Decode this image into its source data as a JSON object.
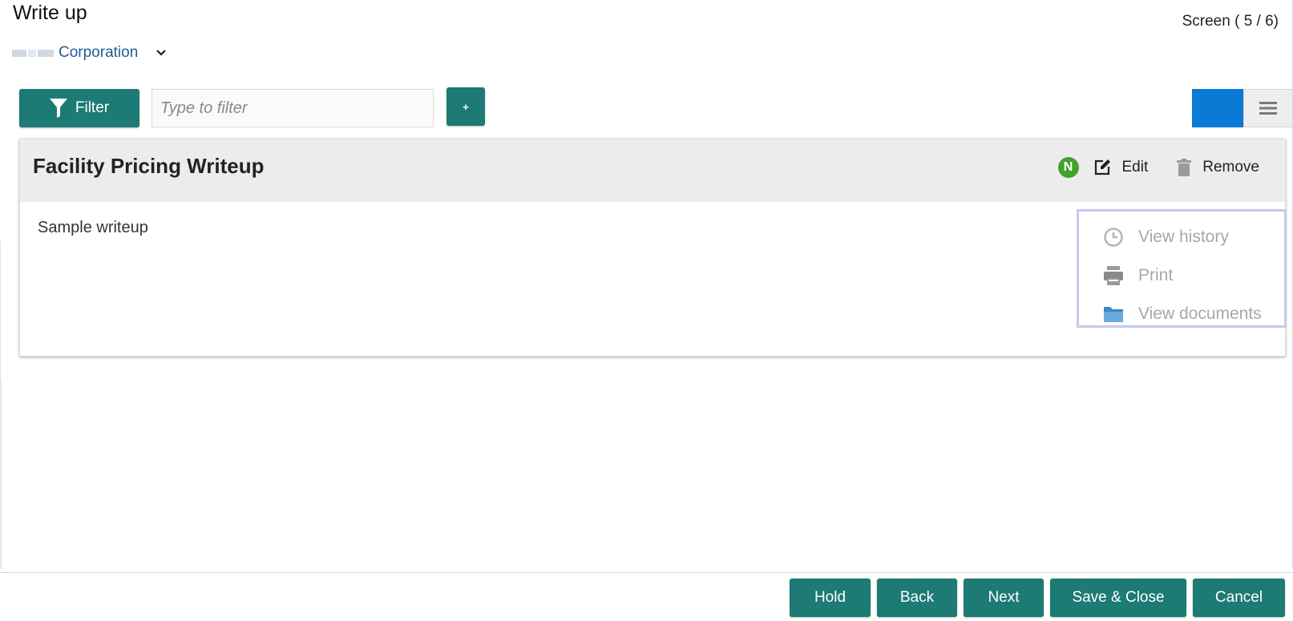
{
  "page": {
    "title": "Write up",
    "screen_indicator": "Screen ( 5 / 6)"
  },
  "entity": {
    "name": "Corporation",
    "chevron_icon": "chevron-down-icon"
  },
  "toolbar": {
    "filter_label": "Filter",
    "filter_placeholder": "Type to filter",
    "add_label": "+",
    "view_grid_icon": "grid-view-icon",
    "view_list_icon": "list-view-icon"
  },
  "card": {
    "title": "Facility Pricing Writeup",
    "badge": "N",
    "edit_label": "Edit",
    "remove_label": "Remove",
    "body": "Sample writeup"
  },
  "menu": {
    "items": [
      {
        "label": "View history",
        "icon": "clock-icon"
      },
      {
        "label": "Print",
        "icon": "printer-icon"
      },
      {
        "label": "View documents",
        "icon": "folder-icon"
      }
    ]
  },
  "footer": {
    "hold": "Hold",
    "back": "Back",
    "next": "Next",
    "save_close": "Save & Close",
    "cancel": "Cancel"
  },
  "colors": {
    "primary": "#1d7a74",
    "accent_blue": "#0a7ad4",
    "badge_green": "#43a22e",
    "link_blue": "#1f5c99"
  }
}
